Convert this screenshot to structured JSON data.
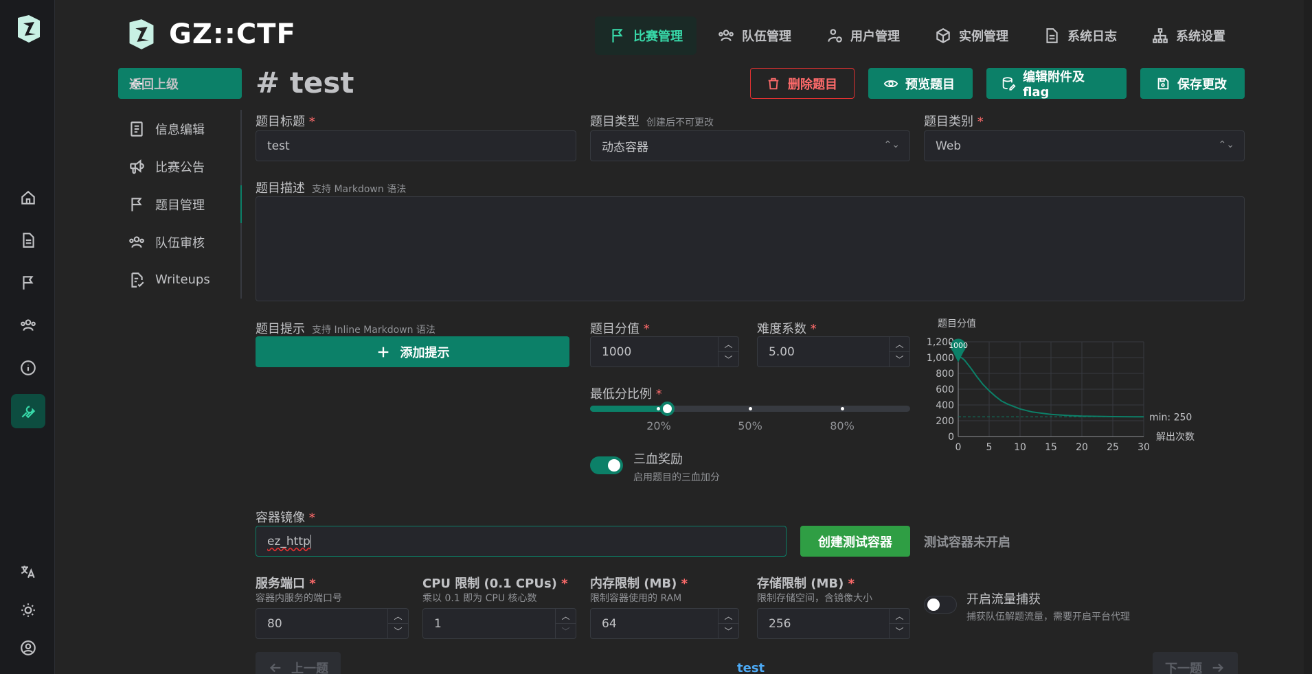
{
  "brand": {
    "name": "GZ::CTF"
  },
  "rail": {
    "items": [
      {
        "name": "home-icon"
      },
      {
        "name": "document-icon"
      },
      {
        "name": "flag-icon"
      },
      {
        "name": "users-icon"
      },
      {
        "name": "info-icon"
      },
      {
        "name": "tool-icon",
        "active": true
      }
    ],
    "bottom": [
      {
        "name": "language-icon"
      },
      {
        "name": "theme-icon"
      },
      {
        "name": "user-circle-icon"
      }
    ]
  },
  "topnav": [
    {
      "label": "比赛管理",
      "icon": "flag-icon",
      "active": true
    },
    {
      "label": "队伍管理",
      "icon": "users-icon"
    },
    {
      "label": "用户管理",
      "icon": "user-settings-icon"
    },
    {
      "label": "实例管理",
      "icon": "box-icon"
    },
    {
      "label": "系统日志",
      "icon": "file-text-icon"
    },
    {
      "label": "系统设置",
      "icon": "hierarchy-icon"
    }
  ],
  "back_button": "返回上级",
  "page_title": "# test",
  "actions": {
    "delete": "删除题目",
    "preview": "预览题目",
    "edit_files": "编辑附件及 flag",
    "save": "保存更改"
  },
  "side_menu": [
    {
      "label": "信息编辑",
      "icon": "notes-icon"
    },
    {
      "label": "比赛公告",
      "icon": "speakerphone-icon"
    },
    {
      "label": "题目管理",
      "icon": "flag-icon",
      "active": true
    },
    {
      "label": "队伍审核",
      "icon": "users-icon"
    },
    {
      "label": "Writeups",
      "icon": "file-check-icon"
    }
  ],
  "form": {
    "title_label": "题目标题",
    "title_value": "test",
    "type_label": "题目类型",
    "type_hint": "创建后不可更改",
    "type_value": "动态容器",
    "category_label": "题目类别",
    "category_value": "Web",
    "desc_label": "题目描述",
    "desc_hint": "支持 Markdown 语法",
    "hint_label": "题目提示",
    "hint_hint": "支持 Inline Markdown 语法",
    "add_hint": "添加提示",
    "score_label": "题目分值",
    "score_value": "1000",
    "difficulty_label": "难度系数",
    "difficulty_value": "5.00",
    "min_ratio_label": "最低分比例",
    "min_ratio": 0.25,
    "slider_marks": [
      "20%",
      "50%",
      "80%"
    ],
    "blood_label": "三血奖励",
    "blood_sub": "启用题目的三血加分",
    "image_label": "容器镜像",
    "image_value": "ez_http",
    "create_test": "创建测试容器",
    "test_status": "测试容器未开启",
    "port_label": "服务端口",
    "port_sub": "容器内服务的端口号",
    "port_value": "80",
    "cpu_label": "CPU 限制 (0.1 CPUs)",
    "cpu_sub": "乘以 0.1 即为 CPU 核心数",
    "cpu_value": "1",
    "mem_label": "内存限制 (MB)",
    "mem_sub": "限制容器使用的 RAM",
    "mem_value": "64",
    "storage_label": "存储限制 (MB)",
    "storage_sub": "限制存储空间，含镜像大小",
    "storage_value": "256",
    "traffic_label": "开启流量捕获",
    "traffic_sub": "捕获队伍解题流量，需要开启平台代理"
  },
  "pager": {
    "prev": "上一题",
    "current": "test",
    "next": "下一题"
  },
  "chart_data": {
    "type": "line",
    "title": "题目分值",
    "xlabel": "解出次数",
    "ylabel": "",
    "xlim": [
      0,
      30
    ],
    "ylim": [
      0,
      1200
    ],
    "xticks": [
      0,
      5,
      10,
      15,
      20,
      25,
      30
    ],
    "yticks": [
      0,
      200,
      400,
      600,
      800,
      1000,
      1200
    ],
    "ytick_labels": [
      "0",
      "200",
      "400",
      "600",
      "800",
      "1,000",
      "1,200"
    ],
    "marker_label": "1000",
    "min_label": "min: 250",
    "min_value": 250,
    "series": [
      {
        "x": [
          0,
          0.5,
          1,
          2,
          3,
          4,
          5,
          6,
          7,
          8,
          10,
          12,
          15,
          18,
          20,
          25,
          30
        ],
        "values": [
          1000,
          1000,
          970,
          870,
          760,
          660,
          580,
          510,
          450,
          410,
          350,
          310,
          280,
          265,
          258,
          252,
          250
        ]
      }
    ],
    "colors": {
      "line": "#0c8068",
      "grid": "#373a40",
      "axis": "#909296"
    }
  }
}
